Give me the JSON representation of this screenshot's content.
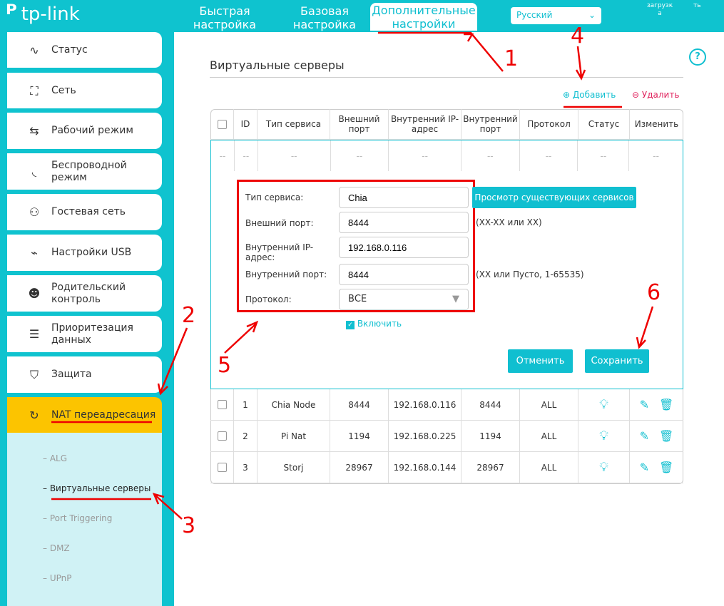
{
  "header": {
    "logo": "tp-link",
    "tabs": [
      "Быстрая настройка",
      "Базовая настройка",
      "Дополнительные настройки"
    ],
    "language": "Русский",
    "right_links": [
      "загрузк а",
      "ть"
    ]
  },
  "sidebar": {
    "items": [
      "Статус",
      "Сеть",
      "Рабочий режим",
      "Беспроводной режим",
      "Гостевая сеть",
      "Настройки USB",
      "Родительский контроль",
      "Приоритезация данных",
      "Защита",
      "NAT переадресация"
    ],
    "sub": [
      "ALG",
      "Виртуальные серверы",
      "Port Triggering",
      "DMZ",
      "UPnP"
    ]
  },
  "page": {
    "title": "Виртуальные серверы",
    "add": "Добавить",
    "delete": "Удалить"
  },
  "table": {
    "headers": [
      "ID",
      "Тип сервиса",
      "Внешний порт",
      "Внутренний IP-адрес",
      "Внутренний порт",
      "Протокол",
      "Статус",
      "Изменить"
    ],
    "empty": "--",
    "rows": [
      [
        "1",
        "Chia Node",
        "8444",
        "192.168.0.116",
        "8444",
        "ALL"
      ],
      [
        "2",
        "Pi Nat",
        "1194",
        "192.168.0.225",
        "1194",
        "ALL"
      ],
      [
        "3",
        "Storj",
        "28967",
        "192.168.0.144",
        "28967",
        "ALL"
      ]
    ]
  },
  "form": {
    "service_label": "Тип сервиса:",
    "service": "Chia",
    "view_btn": "Просмотр существующих сервисов",
    "ext_label": "Внешний порт:",
    "ext": "8444",
    "ext_hint": "(XX-XX или XX)",
    "ip_label": "Внутренний IP-адрес:",
    "ip": "192.168.0.116",
    "int_label": "Внутренний порт:",
    "int": "8444",
    "int_hint": "(XX или Пусто, 1-65535)",
    "proto_label": "Протокол:",
    "proto": "ВСЕ",
    "enable": "Включить",
    "cancel": "Отменить",
    "save": "Сохранить"
  },
  "annotations": [
    "1",
    "2",
    "3",
    "4",
    "5",
    "6"
  ],
  "colors": {
    "accent": "#10bfd0",
    "active": "#fcc400",
    "annot": "#e00000"
  }
}
